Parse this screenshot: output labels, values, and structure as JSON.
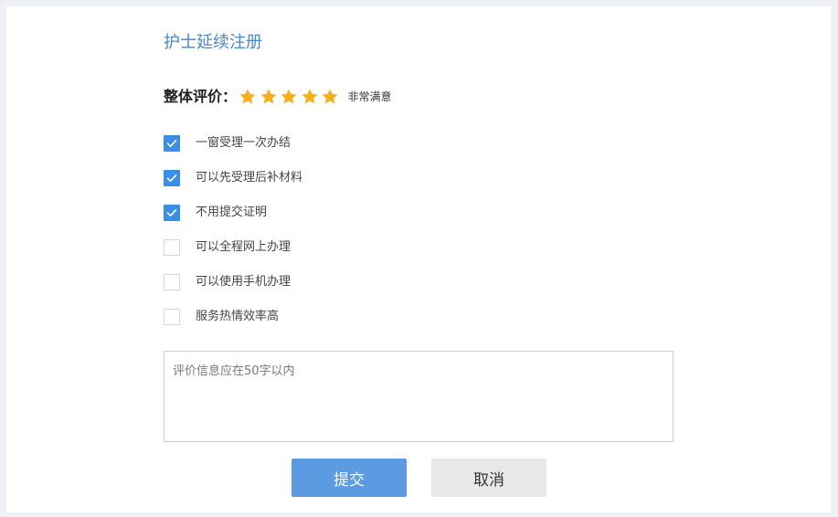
{
  "page": {
    "title": "护士延续注册"
  },
  "rating": {
    "label": "整体评价：",
    "stars_filled": 5,
    "stars_total": 5,
    "star_color": "#f5b01a",
    "text": "非常满意"
  },
  "options": [
    {
      "label": "一窗受理一次办结",
      "checked": true
    },
    {
      "label": "可以先受理后补材料",
      "checked": true
    },
    {
      "label": "不用提交证明",
      "checked": true
    },
    {
      "label": "可以全程网上办理",
      "checked": false
    },
    {
      "label": "可以使用手机办理",
      "checked": false
    },
    {
      "label": "服务热情效率高",
      "checked": false
    }
  ],
  "comment": {
    "placeholder": "评价信息应在50字以内",
    "value": ""
  },
  "buttons": {
    "submit_label": "提交",
    "cancel_label": "取消"
  },
  "colors": {
    "accent": "#3a8ee6",
    "title": "#4a86c8",
    "submit_bg": "#5c9ae2",
    "cancel_bg": "#e8e8e8"
  },
  "icons": {
    "star": "star-icon",
    "check": "check-icon"
  }
}
